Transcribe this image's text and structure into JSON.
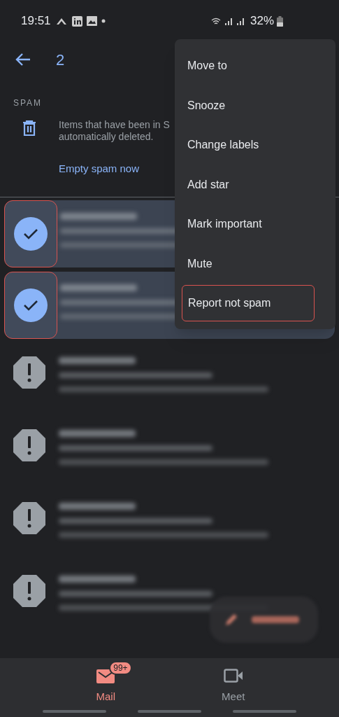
{
  "status_bar": {
    "time": "19:51",
    "battery": "32%"
  },
  "top_bar": {
    "selected_count": "2"
  },
  "spam_notice": {
    "heading": "SPAM",
    "lines": [
      "Items that have been in S",
      "automatically deleted."
    ],
    "action": "Empty spam now"
  },
  "emails": [
    {
      "selected": true,
      "annotated": true
    },
    {
      "selected": true,
      "annotated": true
    },
    {
      "selected": false,
      "annotated": false
    },
    {
      "selected": false,
      "annotated": false
    },
    {
      "selected": false,
      "annotated": false
    },
    {
      "selected": false,
      "annotated": false
    }
  ],
  "menu": [
    {
      "label": "Move to",
      "annotated": false
    },
    {
      "label": "Snooze",
      "annotated": false
    },
    {
      "label": "Change labels",
      "annotated": false
    },
    {
      "label": "Add star",
      "annotated": false
    },
    {
      "label": "Mark important",
      "annotated": false
    },
    {
      "label": "Mute",
      "annotated": false
    },
    {
      "label": "Report not spam",
      "annotated": true
    }
  ],
  "bottom_nav": [
    {
      "kind": "mail",
      "label": "Mail",
      "badge": "99+",
      "selected": true
    },
    {
      "kind": "meet",
      "label": "Meet",
      "selected": false
    }
  ]
}
